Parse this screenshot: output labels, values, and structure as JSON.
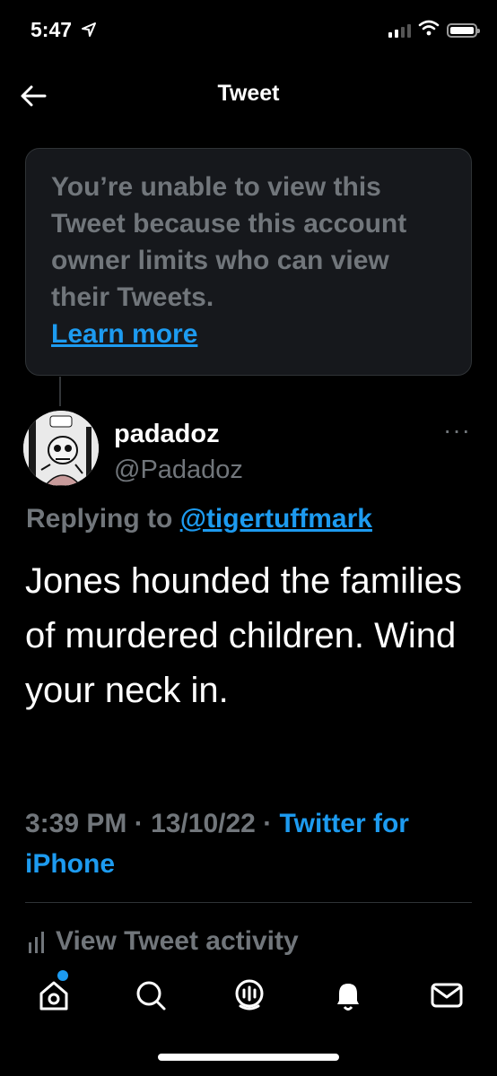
{
  "status_bar": {
    "time": "5:47"
  },
  "header": {
    "title": "Tweet"
  },
  "notice": {
    "text": "You’re unable to view this Tweet because this account owner limits who can view their Tweets.",
    "link": "Learn more"
  },
  "tweet": {
    "display_name": "padadoz",
    "handle": "@Padadoz",
    "reply_prefix": "Replying to",
    "reply_to": "@tigertuffmark",
    "text": "Jones hounded the families of murdered children. Wind your neck in.",
    "time": "3:39 PM",
    "date": "13/10/22",
    "source": "Twitter for iPhone",
    "more_label": "···"
  },
  "activity": {
    "label": "View Tweet activity"
  },
  "nav": {
    "items": [
      {
        "icon": "home-icon",
        "has_dot": true
      },
      {
        "icon": "search-icon"
      },
      {
        "icon": "spaces-icon"
      },
      {
        "icon": "notifications-icon"
      },
      {
        "icon": "messages-icon"
      }
    ]
  },
  "colors": {
    "accent": "#1d9bf0",
    "muted": "#71767b",
    "background": "#000000"
  }
}
